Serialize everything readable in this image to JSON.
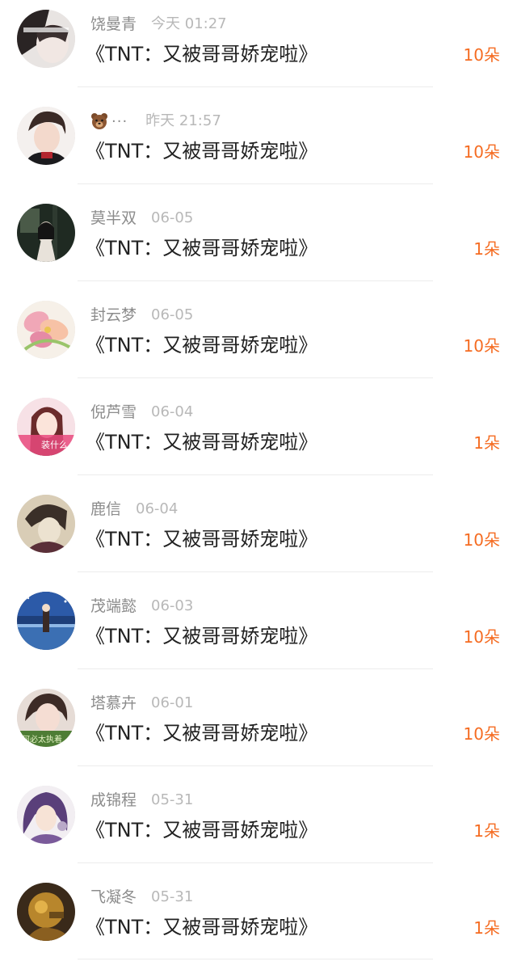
{
  "gift_color": "#f56c22",
  "rows": [
    {
      "name": "饶曼青",
      "time": "今天 01:27",
      "title": "《TNT：又被哥哥娇宠啦》",
      "gift": "10朵",
      "avatar": "avatar-photo-girl-dark"
    },
    {
      "name": "",
      "name_icon": "bear-emoji-icon",
      "name_suffix": "···",
      "time": "昨天 21:57",
      "title": "《TNT：又被哥哥娇宠啦》",
      "gift": "10朵",
      "avatar": "avatar-photo-boy"
    },
    {
      "name": "莫半双",
      "time": "06-05",
      "title": "《TNT：又被哥哥娇宠啦》",
      "gift": "1朵",
      "avatar": "avatar-photo-dark-scene"
    },
    {
      "name": "封云梦",
      "time": "06-05",
      "title": "《TNT：又被哥哥娇宠啦》",
      "gift": "10朵",
      "avatar": "avatar-flowers"
    },
    {
      "name": "倪芦雪",
      "time": "06-04",
      "title": "《TNT：又被哥哥娇宠啦》",
      "gift": "1朵",
      "avatar": "avatar-anime-girl-pink",
      "avatar_text": "装什么"
    },
    {
      "name": "鹿信",
      "time": "06-04",
      "title": "《TNT：又被哥哥娇宠啦》",
      "gift": "10朵",
      "avatar": "avatar-anime-boy-sepia"
    },
    {
      "name": "茂端懿",
      "time": "06-03",
      "title": "《TNT：又被哥哥娇宠啦》",
      "gift": "10朵",
      "avatar": "avatar-anime-night-sky"
    },
    {
      "name": "塔慕卉",
      "time": "06-01",
      "title": "《TNT：又被哥哥娇宠啦》",
      "gift": "10朵",
      "avatar": "avatar-photo-girl-green",
      "avatar_text": "何必太执着"
    },
    {
      "name": "成锦程",
      "time": "05-31",
      "title": "《TNT：又被哥哥娇宠啦》",
      "gift": "1朵",
      "avatar": "avatar-anime-purple-hair"
    },
    {
      "name": "飞凝冬",
      "time": "05-31",
      "title": "《TNT：又被哥哥娇宠啦》",
      "gift": "1朵",
      "avatar": "avatar-game-character-gold"
    }
  ]
}
